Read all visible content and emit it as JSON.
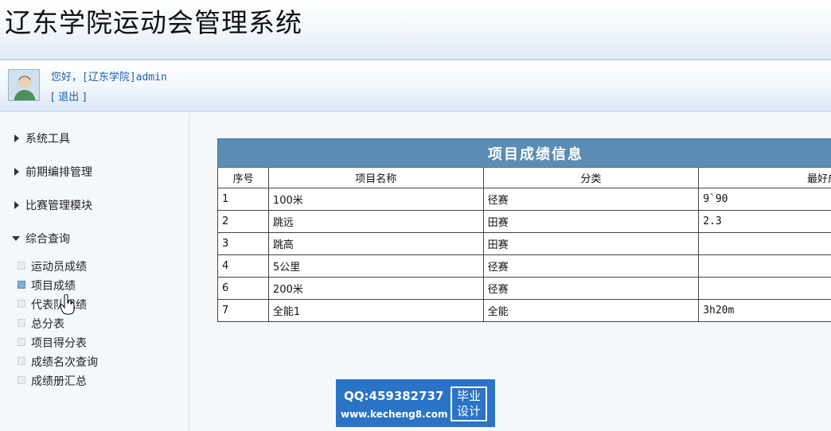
{
  "header": {
    "title": "辽东学院运动会管理系统"
  },
  "user": {
    "greeting": "您好，[辽东学院]admin",
    "logout": "[ 退出 ]"
  },
  "sidebar": {
    "groups": [
      {
        "label": "系统工具",
        "expanded": false
      },
      {
        "label": "前期编排管理",
        "expanded": false
      },
      {
        "label": "比赛管理模块",
        "expanded": false
      },
      {
        "label": "综合查询",
        "expanded": true
      }
    ],
    "sub_items": [
      {
        "label": "运动员成绩",
        "active": false
      },
      {
        "label": "项目成绩",
        "active": true
      },
      {
        "label": "代表队成绩",
        "active": false
      },
      {
        "label": "总分表",
        "active": false
      },
      {
        "label": "项目得分表",
        "active": false
      },
      {
        "label": "成绩名次查询",
        "active": false
      },
      {
        "label": "成绩册汇总",
        "active": false
      }
    ]
  },
  "table": {
    "title": "项目成绩信息",
    "headers": [
      "序号",
      "项目名称",
      "分类",
      "最好成绩"
    ],
    "rows": [
      [
        "1",
        "100米",
        "径赛",
        "9`90"
      ],
      [
        "2",
        "跳远",
        "田赛",
        "2.3"
      ],
      [
        "3",
        "跳高",
        "田赛",
        ""
      ],
      [
        "4",
        "5公里",
        "径赛",
        ""
      ],
      [
        "6",
        "200米",
        "径赛",
        ""
      ],
      [
        "7",
        "全能1",
        "全能",
        "3h20m"
      ]
    ]
  },
  "watermark": {
    "qq": "QQ:459382737",
    "url": "www.kecheng8.com",
    "badge_line1": "毕业",
    "badge_line2": "设计"
  },
  "colors": {
    "accent": "#5b8db4",
    "link": "#1f5fa8"
  }
}
